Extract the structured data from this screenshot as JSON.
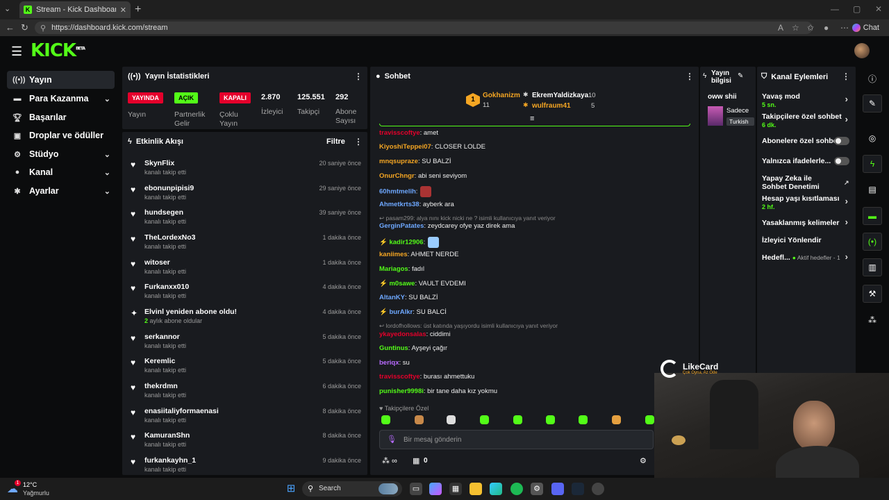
{
  "browser": {
    "tab_title": "Stream - Kick Dashboard",
    "favicon_letter": "K",
    "url": "https://dashboard.kick.com/stream",
    "chat_button": "Chat"
  },
  "header": {
    "logo": "KICK",
    "logo_badge": "BETA"
  },
  "sidebar": {
    "items": [
      {
        "label": "Yayın",
        "icon": "broadcast-icon",
        "active": true
      },
      {
        "label": "Para Kazanma",
        "icon": "money-icon",
        "chevron": true
      },
      {
        "label": "Başarılar",
        "icon": "trophy-icon"
      },
      {
        "label": "Droplar ve ödüller",
        "icon": "gift-icon"
      },
      {
        "label": "Stüdyo",
        "icon": "studio-icon",
        "chevron": true
      },
      {
        "label": "Kanal",
        "icon": "user-icon",
        "chevron": true
      },
      {
        "label": "Ayarlar",
        "icon": "gear-icon",
        "chevron": true
      }
    ]
  },
  "stats_panel": {
    "title": "Yayın İstatistikleri",
    "items": [
      {
        "badge": "YAYINDA",
        "label": "Yayın",
        "badge_color": "#e5002b"
      },
      {
        "badge": "AÇIK",
        "label": "Partnerlik Gelir",
        "badge_color": "#53fc18"
      },
      {
        "badge": "KAPALI",
        "label": "Çoklu Yayın",
        "badge_color": "#e5002b"
      },
      {
        "value": "2.870",
        "label": "İzleyici"
      },
      {
        "value": "125.551",
        "label": "Takipçi"
      },
      {
        "value": "292",
        "label": "Abone Sayısı"
      }
    ]
  },
  "activity": {
    "title": "Etkinlik Akışı",
    "filter": "Filtre",
    "rows": [
      {
        "name": "SkynFlix",
        "sub": "kanalı takip etti",
        "time": "20 saniye önce",
        "icon": "heart"
      },
      {
        "name": "ebonunpipisi9",
        "sub": "kanalı takip etti",
        "time": "29 saniye önce",
        "icon": "heart"
      },
      {
        "name": "hundsegen",
        "sub": "kanalı takip etti",
        "time": "39 saniye önce",
        "icon": "heart"
      },
      {
        "name": "TheLordexNo3",
        "sub": "kanalı takip etti",
        "time": "1 dakika önce",
        "icon": "heart"
      },
      {
        "name": "witoser",
        "sub": "kanalı takip etti",
        "time": "1 dakika önce",
        "icon": "heart"
      },
      {
        "name": "Furkanxx010",
        "sub": "kanalı takip etti",
        "time": "4 dakika önce",
        "icon": "heart"
      },
      {
        "name": "Elvinl yeniden abone oldu!",
        "sub_highlight": "2",
        "sub": "aylık abone oldular",
        "time": "4 dakika önce",
        "icon": "sparkle"
      },
      {
        "name": "serkannor",
        "sub": "kanalı takip etti",
        "time": "5 dakika önce",
        "icon": "heart"
      },
      {
        "name": "Keremlic",
        "sub": "kanalı takip etti",
        "time": "5 dakika önce",
        "icon": "heart"
      },
      {
        "name": "thekrdmn",
        "sub": "kanalı takip etti",
        "time": "6 dakika önce",
        "icon": "heart"
      },
      {
        "name": "enasiitaliyformaenasi",
        "sub": "kanalı takip etti",
        "time": "8 dakika önce",
        "icon": "heart"
      },
      {
        "name": "KamuranShn",
        "sub": "kanalı takip etti",
        "time": "8 dakika önce",
        "icon": "heart"
      },
      {
        "name": "furkankayhn_1",
        "sub": "kanalı takip etti",
        "time": "9 dakika önce",
        "icon": "heart"
      }
    ]
  },
  "chat": {
    "title": "Sohbet",
    "leaderboard": {
      "rank": "1",
      "first_name": "Gokhanizm",
      "first_count": "11",
      "second_name": "EkremYaldizkaya",
      "second_count": "10",
      "third_name": "wulfraum41",
      "third_count": "5"
    },
    "messages": [
      {
        "user": "travisscoftye",
        "color": "#e5002b",
        "text": ": amet"
      },
      {
        "user": "KiyoshiTeppei07",
        "color": "#f5a623",
        "text": ": CLOSER LOLDE"
      },
      {
        "user": "mnqsupraze",
        "color": "#f5a623",
        "text": ": SU BALZİ"
      },
      {
        "user": "OnurChngr",
        "color": "#f5a623",
        "text": ": abi seni seviyom"
      },
      {
        "user": "60hmtmelih",
        "color": "#6ea8ff",
        "text": ":",
        "emote": "#a33"
      },
      {
        "user": "Ahmetkrts38",
        "color": "#6ea8ff",
        "text": ": ayberk ara"
      },
      {
        "reply": "pasam299: alya nını kick nicki ne ? isimli kullanıcıya yanıt veriyor"
      },
      {
        "user": "GerginPatates",
        "color": "#6ea8ff",
        "text": ": zeydcarey ofye yaz direk ama"
      },
      {
        "user": "kadir12906",
        "color": "#53fc18",
        "text": ":",
        "emote": "#9cf",
        "badge": true
      },
      {
        "user": "kaniimes",
        "color": "#f5a623",
        "text": ": AHMET NERDE"
      },
      {
        "user": "Mariagos",
        "color": "#53fc18",
        "text": ": fadıl"
      },
      {
        "user": "m0sawe",
        "color": "#53fc18",
        "text": ": VAULT EVDEMI",
        "badge": true
      },
      {
        "user": "AltanKY",
        "color": "#6ea8ff",
        "text": ": SU BALZİ"
      },
      {
        "user": "burAlkr",
        "color": "#6ea8ff",
        "text": ": SU BALCİ",
        "badge": true
      },
      {
        "reply": "lordofhollows: üst katında yaşıyordu isimli kullanıcıya yanıt veriyor"
      },
      {
        "user": "ykayedonsalas",
        "color": "#e5002b",
        "text": ": ciddimi"
      },
      {
        "user": "Guntinus",
        "color": "#53fc18",
        "text": ": Ayşeyi çağır"
      },
      {
        "user": "beriqx",
        "color": "#b86bff",
        "text": ": su"
      },
      {
        "user": "travisscoftye",
        "color": "#e5002b",
        "text": ": burası ahmettuku"
      },
      {
        "user": "punisher9998i",
        "color": "#53fc18",
        "text": ": bir tane daha kız yokmu"
      }
    ],
    "followers_only": "Takipçilere Özel",
    "input_placeholder": "Bir mesaj gönderin",
    "bottom_count": "0"
  },
  "stream_info": {
    "title": "Yayın bilgisi",
    "stream_title": "oww shii",
    "category": "Sadece",
    "language": "Turkish"
  },
  "channel_actions": {
    "title": "Kanal Eylemleri",
    "rows": [
      {
        "label": "Yavaş mod",
        "sub": "5 sn.",
        "type": "chevron"
      },
      {
        "label": "Takipçilere özel sohbet",
        "sub": "6 dk.",
        "type": "chevron"
      },
      {
        "label": "Abonelere özel sohbet",
        "type": "toggle"
      },
      {
        "label": "Yalnızca ifadelerle...",
        "type": "toggle"
      },
      {
        "label": "Yapay Zeka ile Sohbet Denetimi",
        "type": "external"
      },
      {
        "label": "Hesap yaşı kısıtlaması",
        "sub": "2 hf.",
        "type": "chevron"
      },
      {
        "label": "Yasaklanmış kelimeler",
        "type": "chevron"
      },
      {
        "label": "İzleyici Yönlendir",
        "type": "none"
      },
      {
        "label": "Hedefl...",
        "sub_inline": "Aktif hedefler - 1",
        "type": "chevron"
      }
    ]
  },
  "overlay": {
    "brand": "LikeCard",
    "tagline": "Çok Oyna, Az Öde"
  },
  "taskbar": {
    "weather_temp": "12°C",
    "weather_desc": "Yağmurlu",
    "search": "Search"
  }
}
